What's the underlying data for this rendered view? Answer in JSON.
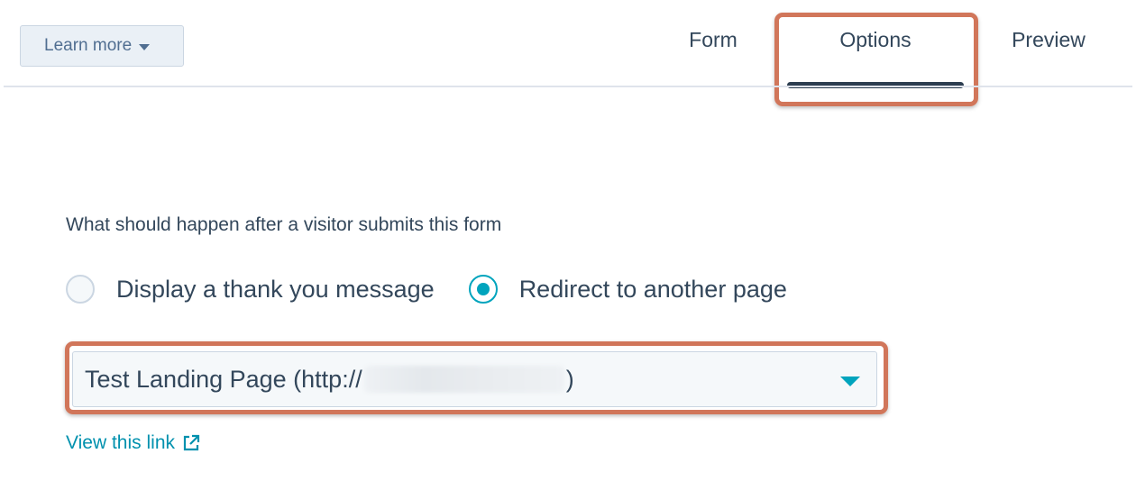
{
  "header": {
    "learn_more_label": "Learn more",
    "tabs": [
      {
        "label": "Form",
        "active": false
      },
      {
        "label": "Options",
        "active": true
      },
      {
        "label": "Preview",
        "active": false
      }
    ]
  },
  "options": {
    "question": "What should happen after a visitor submits this form",
    "radio_options": [
      {
        "label": "Display a thank you message",
        "checked": false
      },
      {
        "label": "Redirect to another page",
        "checked": true
      }
    ],
    "redirect_select": {
      "value_prefix": "Test Landing Page (http://",
      "value_suffix": ")"
    },
    "view_link_label": "View this link"
  },
  "colors": {
    "accent": "#00a4bd",
    "link": "#0091ae",
    "text": "#33475b",
    "highlight": "#d1765a",
    "tab_underline": "#2d3e50"
  },
  "icons": {
    "learn_more": "caret-down-icon",
    "select": "caret-down-icon",
    "view_link": "external-link-icon"
  }
}
